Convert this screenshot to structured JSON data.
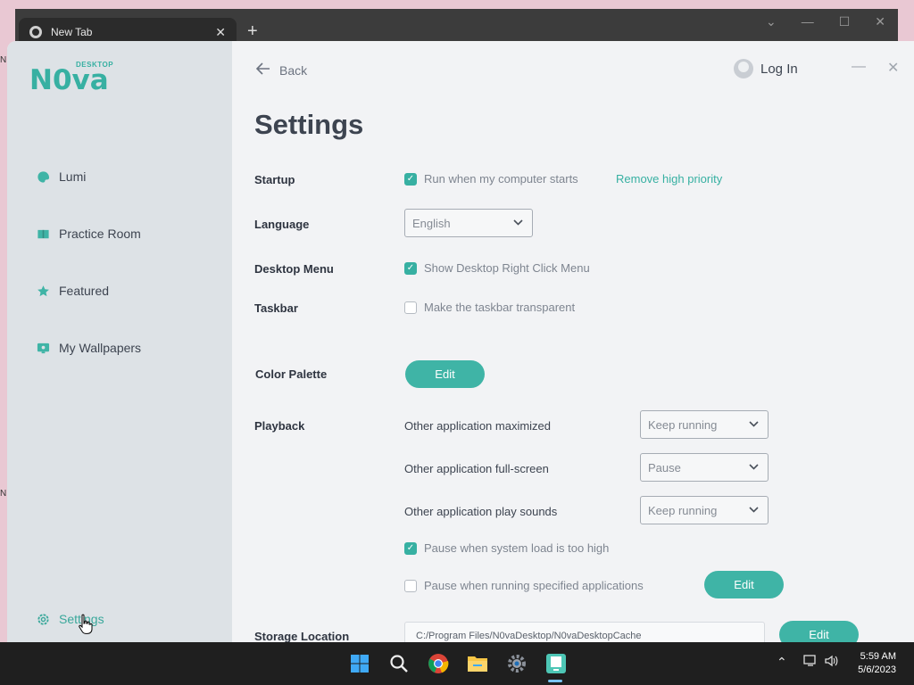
{
  "browser": {
    "tab_title": "New Tab",
    "tab_close": "✕",
    "new_tab": "+"
  },
  "app": {
    "logo": {
      "main": "N0va",
      "sub": "DESKTOP"
    },
    "nav": [
      {
        "label": "Lumi",
        "icon": "lumi-icon"
      },
      {
        "label": "Practice Room",
        "icon": "book-icon"
      },
      {
        "label": "Featured",
        "icon": "star-icon"
      },
      {
        "label": "My Wallpapers",
        "icon": "monitor-icon"
      }
    ],
    "settings_nav": {
      "label": "Settings",
      "icon": "gear-icon"
    },
    "header": {
      "back_label": "Back",
      "login_label": "Log In"
    },
    "title": "Settings",
    "startup": {
      "label": "Startup",
      "checkbox_label": "Run when my computer starts",
      "checked": true,
      "link": "Remove high priority"
    },
    "language": {
      "label": "Language",
      "value": "English"
    },
    "desktop_menu": {
      "label": "Desktop Menu",
      "checkbox_label": "Show Desktop Right Click Menu",
      "checked": true
    },
    "taskbar": {
      "label": "Taskbar",
      "checkbox_label": "Make the taskbar transparent",
      "checked": false
    },
    "color_palette": {
      "label": "Color Palette",
      "button": "Edit"
    },
    "playback": {
      "label": "Playback",
      "rows": [
        {
          "label": "Other application maximized",
          "value": "Keep running"
        },
        {
          "label": "Other application full-screen",
          "value": "Pause"
        },
        {
          "label": "Other application play sounds",
          "value": "Keep running"
        }
      ],
      "pause_load": {
        "label": "Pause when system load is too high",
        "checked": true
      },
      "pause_apps": {
        "label": "Pause when running specified applications",
        "checked": false,
        "button": "Edit"
      }
    },
    "storage": {
      "label": "Storage Location",
      "path": "C:/Program Files/N0vaDesktop/N0vaDesktopCache",
      "button": "Edit"
    }
  },
  "os_taskbar": {
    "time": "5:59 AM",
    "date": "5/6/2023"
  },
  "colors": {
    "accent": "#37b0a2",
    "sidebar_bg": "#dde2e6",
    "main_bg": "#f2f3f5",
    "taskbar_bg": "#1f1f1f"
  }
}
